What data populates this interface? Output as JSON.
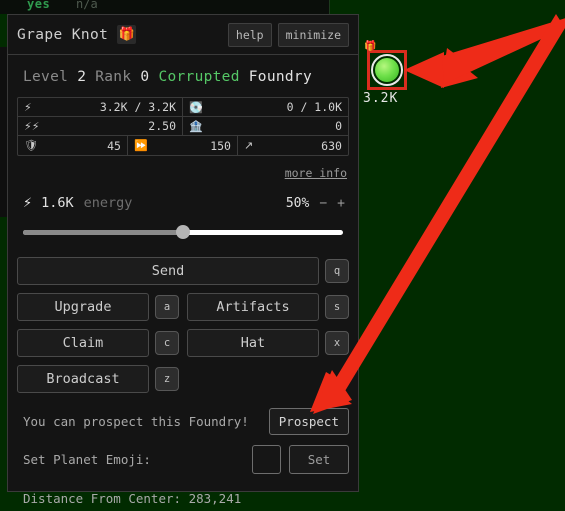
{
  "background": {
    "color": "#012b00"
  },
  "hud": {
    "yes": "yes",
    "na": "n/a"
  },
  "panel": {
    "title": "Grape Knot",
    "title_emoji": "🎁",
    "title_emoji_name": "gift-icon",
    "help_label": "help",
    "minimize_label": "minimize",
    "subtitle": {
      "level_label": "Level",
      "level_value": "2",
      "rank_label": "Rank",
      "rank_value": "0",
      "modifier": "Corrupted",
      "modifier_color": "#55c766",
      "type": "Foundry"
    },
    "stats": {
      "rows": [
        [
          {
            "icon": "⚡",
            "icon_name": "energy-bolt-icon",
            "value": "3.2K / 3.2K",
            "width": "half"
          },
          {
            "icon": "💽",
            "icon_name": "silver-icon",
            "value": "0 / 1.0K",
            "width": "half"
          }
        ],
        [
          {
            "icon": "⚡⚡",
            "icon_name": "energy-regen-icon",
            "value": "2.50",
            "width": "half"
          },
          {
            "icon": "🏦",
            "icon_name": "bank-icon",
            "value": "0",
            "width": "half"
          }
        ],
        [
          {
            "icon": "🛡",
            "icon_name": "defense-icon",
            "value": "45",
            "width": "third"
          },
          {
            "icon": "⏩",
            "icon_name": "speed-icon",
            "value": "150",
            "width": "third"
          },
          {
            "icon": "↗",
            "icon_name": "range-icon",
            "value": "630",
            "width": "third"
          }
        ]
      ],
      "more_info": "more info"
    },
    "energy": {
      "icon": "⚡",
      "amount": "1.6K",
      "label": "energy",
      "percent": "50%",
      "percent_value": 50,
      "minus": "−",
      "plus": "+"
    },
    "buttons": [
      {
        "label": "Send",
        "key": "q",
        "layout": "wide"
      },
      {
        "label": "Upgrade",
        "key": "a",
        "layout": "pair",
        "label2": "Artifacts",
        "key2": "s"
      },
      {
        "label": "Claim",
        "key": "c",
        "layout": "pair",
        "label2": "Hat",
        "key2": "x"
      },
      {
        "label": "Broadcast",
        "key": "z",
        "layout": "single"
      }
    ],
    "footer": {
      "prospect_message": "You can prospect this Foundry!",
      "prospect_button": "Prospect",
      "emoji_label": "Set Planet Emoji:",
      "emoji_value": "",
      "set_button": "Set",
      "distance_text": "Distance From Center: 283,241"
    }
  },
  "map": {
    "planet": {
      "label": "3.2K",
      "gift_icon": "🎁",
      "selection_color": "#d82d1e",
      "body_color": "#6fe04a"
    }
  },
  "annotations": {
    "arrow_color": "#ee2b18",
    "arrow_count": 2
  }
}
